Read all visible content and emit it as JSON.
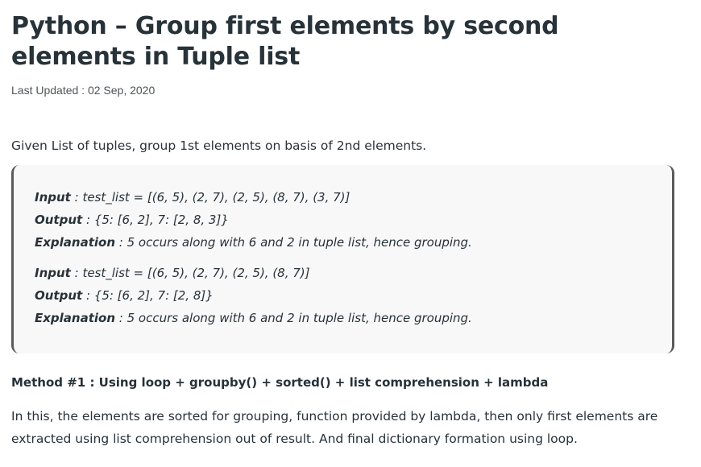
{
  "article": {
    "title": "Python – Group first elements by second elements in Tuple list",
    "last_updated": "Last Updated : 02 Sep, 2020",
    "intro": "Given List of tuples, group 1st elements on basis of 2nd elements."
  },
  "examples": [
    {
      "input_label": "Input",
      "input_text": " : test_list = [(6, 5), (2, 7), (2, 5), (8, 7), (3, 7)]",
      "output_label": "Output",
      "output_text": " : {5: [6, 2], 7: [2, 8, 3]}",
      "explanation_label": "Explanation",
      "explanation_text": " : 5 occurs along with 6 and 2 in tuple list, hence grouping."
    },
    {
      "input_label": "Input",
      "input_text": " : test_list = [(6, 5), (2, 7), (2, 5), (8, 7)]",
      "output_label": "Output",
      "output_text": " : {5: [6, 2], 7: [2, 8]}",
      "explanation_label": "Explanation",
      "explanation_text": " : 5 occurs along with 6 and 2 in tuple list, hence grouping."
    }
  ],
  "method": {
    "heading": "Method #1 : Using loop + groupby() + sorted() + list comprehension + lambda",
    "description": "In this, the elements are sorted for grouping, function provided by lambda, then only first elements are extracted using list comprehension out of result. And final dictionary formation using loop."
  }
}
